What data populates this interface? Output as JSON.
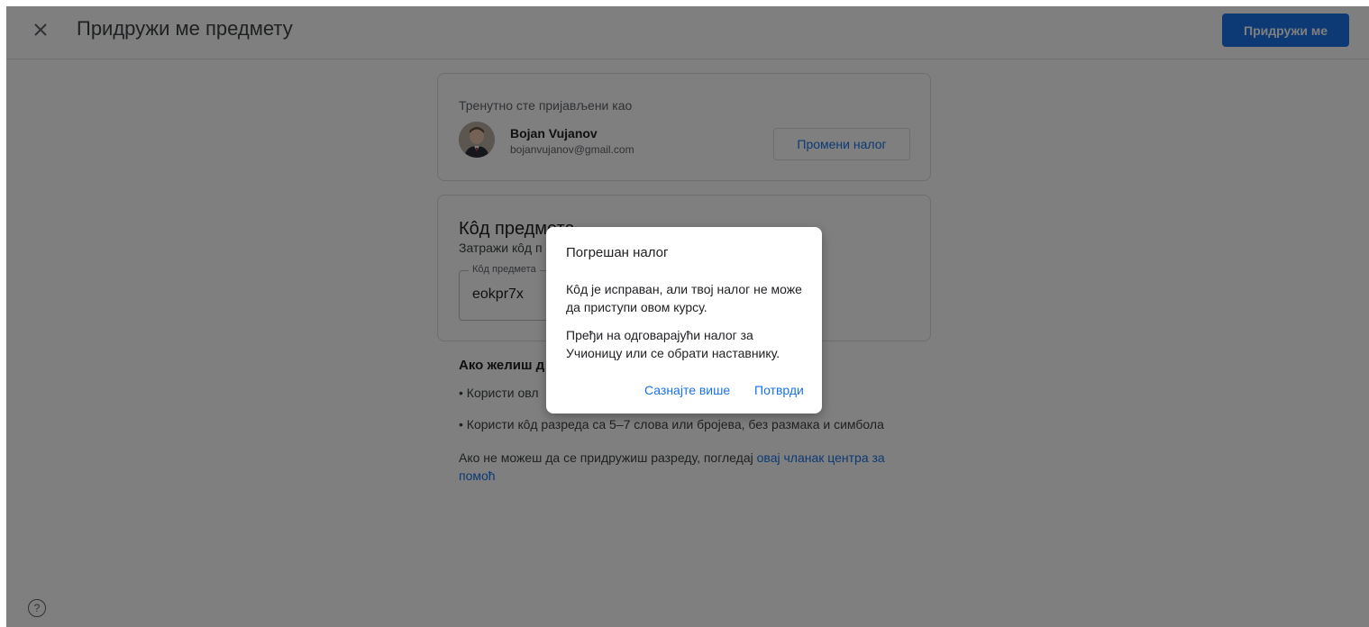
{
  "header": {
    "close_icon": "close-icon",
    "title": "Придружи ме предмету",
    "join_label": "Придружи ме"
  },
  "account": {
    "signed_in_as": "Тренутно сте пријављени као",
    "name": "Bojan Vujanov",
    "email": "bojanvujanov@gmail.com",
    "switch_label": "Промени налог"
  },
  "class_code": {
    "title": "Кôд предмета",
    "subtitle": "Затражи кôд п",
    "field_label": "Кôд предмета",
    "field_value": "eokpr7x"
  },
  "howto": {
    "title": "Ако желиш д",
    "bullet1": "Користи овл",
    "bullet2": "Користи кôд разреда са 5–7 слова или бројева, без размака и симбола",
    "help_prefix": "Ако не можеш да се придружиш разреду, погледај ",
    "help_link": "овај чланак центра за помоћ"
  },
  "dialog": {
    "title": "Погрешан налог",
    "paragraph1": "Кôд је исправан, али твој налог не може да приступи овом курсу.",
    "paragraph2": "Пређи на одговарајући налог за Учионицу или се обрати наставнику.",
    "learn_more": "Сазнајте више",
    "confirm": "Потврди"
  },
  "help_icon": "help-icon",
  "colors": {
    "accent": "#1a73e8",
    "scrim": "rgba(0,0,0,0.5)"
  }
}
